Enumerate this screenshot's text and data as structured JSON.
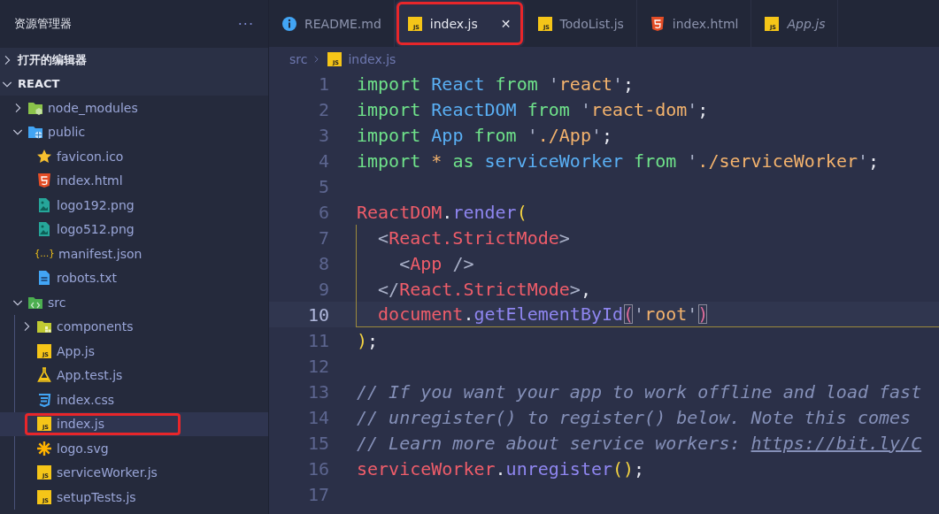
{
  "sidebar": {
    "title": "资源管理器",
    "more": "···",
    "sections": [
      {
        "label": "打开的编辑器",
        "expanded": false
      },
      {
        "label": "REACT",
        "expanded": true
      }
    ],
    "tree": [
      {
        "label": "node_modules",
        "kind": "folder-node",
        "expanded": false,
        "selected": false,
        "highlighted": false
      },
      {
        "label": "public",
        "kind": "folder-public",
        "expanded": true,
        "selected": false,
        "highlighted": false,
        "children": [
          {
            "label": "favicon.ico",
            "kind": "star",
            "selected": false,
            "highlighted": false
          },
          {
            "label": "index.html",
            "kind": "html",
            "selected": false,
            "highlighted": false
          },
          {
            "label": "logo192.png",
            "kind": "image",
            "selected": false,
            "highlighted": false
          },
          {
            "label": "logo512.png",
            "kind": "image",
            "selected": false,
            "highlighted": false
          },
          {
            "label": "manifest.json",
            "kind": "json",
            "icon_text": "{…}",
            "selected": false,
            "highlighted": false
          },
          {
            "label": "robots.txt",
            "kind": "text",
            "selected": false,
            "highlighted": false
          }
        ]
      },
      {
        "label": "src",
        "kind": "folder-src",
        "expanded": true,
        "selected": false,
        "highlighted": false,
        "children": [
          {
            "label": "components",
            "kind": "folder-components",
            "expanded": false,
            "selected": false,
            "highlighted": false
          },
          {
            "label": "App.js",
            "kind": "js",
            "icon_text": "JS",
            "selected": false,
            "highlighted": false
          },
          {
            "label": "App.test.js",
            "kind": "test",
            "selected": false,
            "highlighted": false
          },
          {
            "label": "index.css",
            "kind": "css",
            "selected": false,
            "highlighted": false
          },
          {
            "label": "index.js",
            "kind": "js",
            "icon_text": "JS",
            "selected": true,
            "highlighted": true
          },
          {
            "label": "logo.svg",
            "kind": "svg",
            "selected": false,
            "highlighted": false
          },
          {
            "label": "serviceWorker.js",
            "kind": "js",
            "icon_text": "JS",
            "selected": false,
            "highlighted": false
          },
          {
            "label": "setupTests.js",
            "kind": "js",
            "icon_text": "JS",
            "selected": false,
            "highlighted": false
          }
        ]
      }
    ]
  },
  "tabs": [
    {
      "label": "README.md",
      "kind": "info",
      "selected": false,
      "highlighted": false,
      "preview": false
    },
    {
      "label": "index.js",
      "kind": "js",
      "icon_text": "JS",
      "selected": true,
      "highlighted": true,
      "preview": false,
      "close": "✕"
    },
    {
      "label": "TodoList.js",
      "kind": "js",
      "icon_text": "JS",
      "selected": false,
      "highlighted": false,
      "preview": false
    },
    {
      "label": "index.html",
      "kind": "html",
      "selected": false,
      "highlighted": false,
      "preview": false
    },
    {
      "label": "App.js",
      "kind": "js",
      "icon_text": "JS",
      "selected": false,
      "highlighted": false,
      "preview": true
    }
  ],
  "breadcrumb": [
    {
      "label": "src",
      "kind": "folder"
    },
    {
      "label": "index.js",
      "kind": "js",
      "icon_text": "JS"
    }
  ],
  "code": [
    {
      "number": "1",
      "current": false,
      "guide": false,
      "tokens": [
        {
          "t": "import ",
          "kind": "keyword"
        },
        {
          "t": "React ",
          "kind": "ident"
        },
        {
          "t": "from ",
          "kind": "keyword"
        },
        {
          "t": "'",
          "kind": "quote"
        },
        {
          "t": "react",
          "kind": "string"
        },
        {
          "t": "'",
          "kind": "quote"
        },
        {
          "t": ";",
          "kind": "plain"
        }
      ]
    },
    {
      "number": "2",
      "current": false,
      "guide": false,
      "tokens": [
        {
          "t": "import ",
          "kind": "keyword"
        },
        {
          "t": "ReactDOM ",
          "kind": "ident"
        },
        {
          "t": "from ",
          "kind": "keyword"
        },
        {
          "t": "'",
          "kind": "quote"
        },
        {
          "t": "react-dom",
          "kind": "string"
        },
        {
          "t": "'",
          "kind": "quote"
        },
        {
          "t": ";",
          "kind": "plain"
        }
      ]
    },
    {
      "number": "3",
      "current": false,
      "guide": false,
      "tokens": [
        {
          "t": "import ",
          "kind": "keyword"
        },
        {
          "t": "App ",
          "kind": "ident"
        },
        {
          "t": "from ",
          "kind": "keyword"
        },
        {
          "t": "'",
          "kind": "quote"
        },
        {
          "t": "./App",
          "kind": "string"
        },
        {
          "t": "'",
          "kind": "quote"
        },
        {
          "t": ";",
          "kind": "plain"
        }
      ]
    },
    {
      "number": "4",
      "current": false,
      "guide": false,
      "tokens": [
        {
          "t": "import ",
          "kind": "keyword"
        },
        {
          "t": "* ",
          "kind": "string"
        },
        {
          "t": "as ",
          "kind": "keyword"
        },
        {
          "t": "serviceWorker ",
          "kind": "ident"
        },
        {
          "t": "from ",
          "kind": "keyword"
        },
        {
          "t": "'",
          "kind": "quote"
        },
        {
          "t": "./serviceWorker",
          "kind": "string"
        },
        {
          "t": "'",
          "kind": "quote"
        },
        {
          "t": ";",
          "kind": "plain"
        }
      ]
    },
    {
      "number": "5",
      "current": false,
      "guide": false
    },
    {
      "number": "6",
      "current": false,
      "guide": false,
      "tokens": [
        {
          "t": "ReactDOM",
          "kind": "object"
        },
        {
          "t": ".",
          "kind": "plain"
        },
        {
          "t": "render",
          "kind": "function"
        },
        {
          "t": "(",
          "kind": "bracket"
        }
      ]
    },
    {
      "number": "7",
      "current": false,
      "guide": true,
      "tokens": [
        {
          "t": "  <",
          "kind": "quote"
        },
        {
          "t": "React.StrictMode",
          "kind": "object"
        },
        {
          "t": ">",
          "kind": "quote"
        }
      ]
    },
    {
      "number": "8",
      "current": false,
      "guide": true,
      "tokens": [
        {
          "t": "    <",
          "kind": "quote"
        },
        {
          "t": "App",
          "kind": "object"
        },
        {
          "t": " />",
          "kind": "quote"
        }
      ]
    },
    {
      "number": "9",
      "current": false,
      "guide": true,
      "tokens": [
        {
          "t": "  </",
          "kind": "quote"
        },
        {
          "t": "React.StrictMode",
          "kind": "object"
        },
        {
          "t": ">",
          "kind": "quote"
        },
        {
          "t": ",",
          "kind": "plain"
        }
      ]
    },
    {
      "number": "10",
      "current": true,
      "guide": true,
      "tokens": [
        {
          "t": "  document",
          "kind": "object"
        },
        {
          "t": ".",
          "kind": "plain"
        },
        {
          "t": "getElementById",
          "kind": "function"
        },
        {
          "t": "(",
          "kind": "match"
        },
        {
          "t": "'",
          "kind": "quote"
        },
        {
          "t": "root",
          "kind": "string"
        },
        {
          "t": "'",
          "kind": "quote"
        },
        {
          "t": ")",
          "kind": "match"
        }
      ]
    },
    {
      "number": "11",
      "current": false,
      "guide": false,
      "tokens": [
        {
          "t": ")",
          "kind": "bracket"
        },
        {
          "t": ";",
          "kind": "plain"
        }
      ]
    },
    {
      "number": "12",
      "current": false,
      "guide": false
    },
    {
      "number": "13",
      "current": false,
      "guide": false,
      "tokens": [
        {
          "t": "// If you want your app to work offline and load fast",
          "kind": "comment"
        }
      ]
    },
    {
      "number": "14",
      "current": false,
      "guide": false,
      "tokens": [
        {
          "t": "// unregister() to register() below. Note this comes",
          "kind": "comment"
        }
      ]
    },
    {
      "number": "15",
      "current": false,
      "guide": false,
      "tokens": [
        {
          "t": "// Learn more about service workers: ",
          "kind": "comment"
        },
        {
          "t": "https://bit.ly/C",
          "kind": "link"
        }
      ]
    },
    {
      "number": "16",
      "current": false,
      "guide": false,
      "tokens": [
        {
          "t": "serviceWorker",
          "kind": "object"
        },
        {
          "t": ".",
          "kind": "plain"
        },
        {
          "t": "unregister",
          "kind": "function"
        },
        {
          "t": "()",
          "kind": "bracket"
        },
        {
          "t": ";",
          "kind": "plain"
        }
      ]
    },
    {
      "number": "17",
      "current": false,
      "guide": false
    }
  ]
}
